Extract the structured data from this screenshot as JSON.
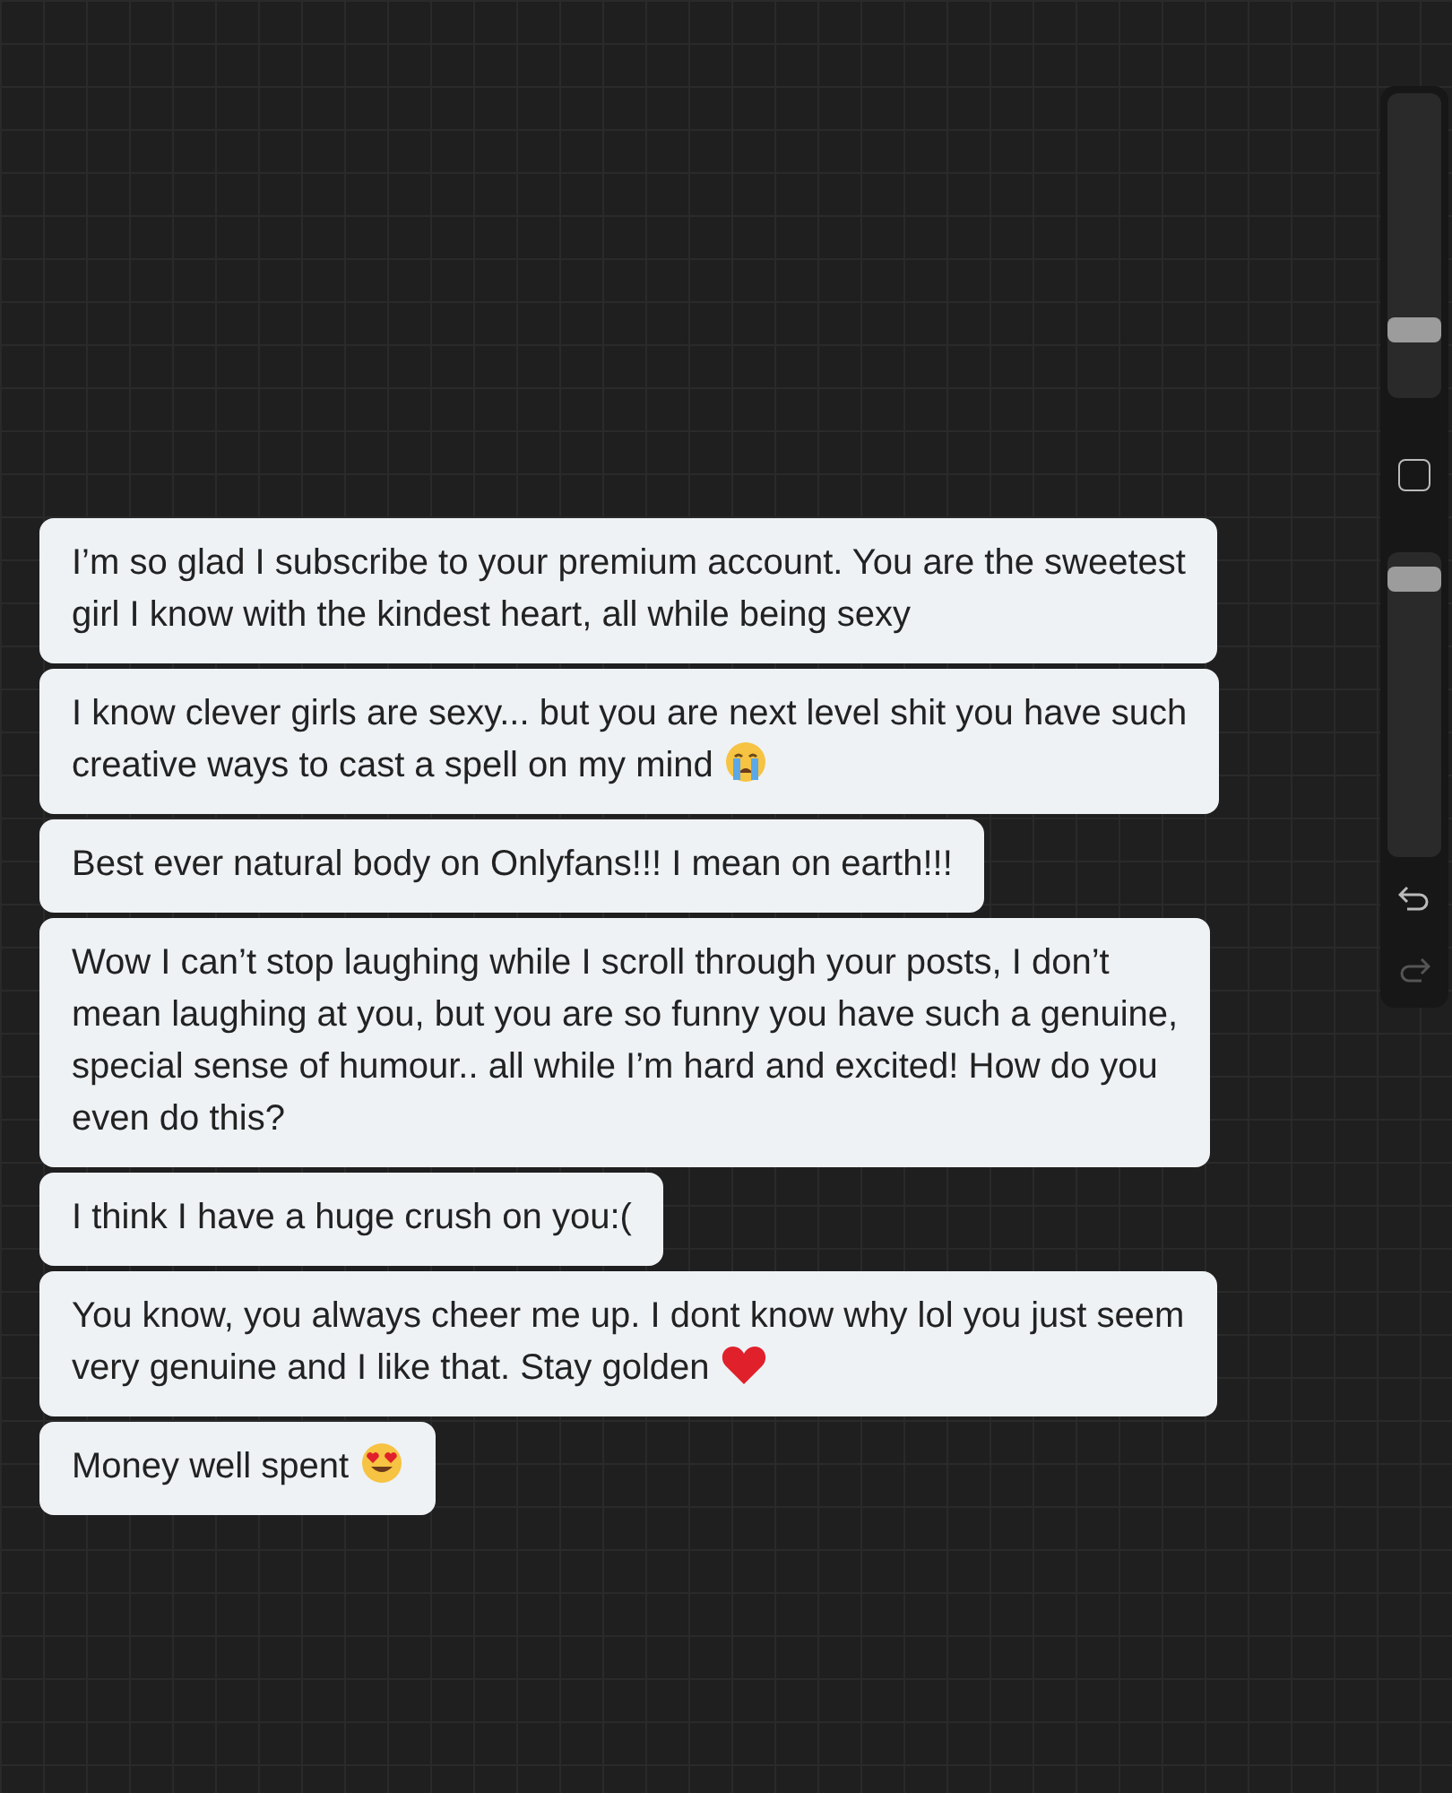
{
  "sidebar": {
    "sliders": [
      {
        "level": 0.2
      },
      {
        "level": 0.95
      }
    ],
    "undo": {
      "disabled": false
    },
    "redo": {
      "disabled": true
    }
  },
  "messages": [
    {
      "kind": "plain",
      "text": "I’m so glad I subscribe to your premium account. You are the sweetest\ngirl I know with the kindest heart, all while being sexy"
    },
    {
      "kind": "crying",
      "text": "I know clever girls are sexy... but you are next level shit you have such\ncreative ways to cast a spell on my mind"
    },
    {
      "kind": "plain",
      "text": "Best ever natural body on Onlyfans!!! I mean on earth!!!"
    },
    {
      "kind": "plain",
      "text": "Wow I can’t stop laughing while I scroll through your posts, I don’t\nmean laughing at you, but you are so funny you have such a genuine,\nspecial sense of humour.. all while I’m hard and excited! How do you\neven do this?"
    },
    {
      "kind": "plain",
      "text": "I think I have a huge crush on you:("
    },
    {
      "kind": "heart",
      "text": "You know, you always cheer me up. I dont know why lol you just seem\nvery genuine and I like that. Stay golden"
    },
    {
      "kind": "hearteyes",
      "text": "Money well spent"
    }
  ]
}
